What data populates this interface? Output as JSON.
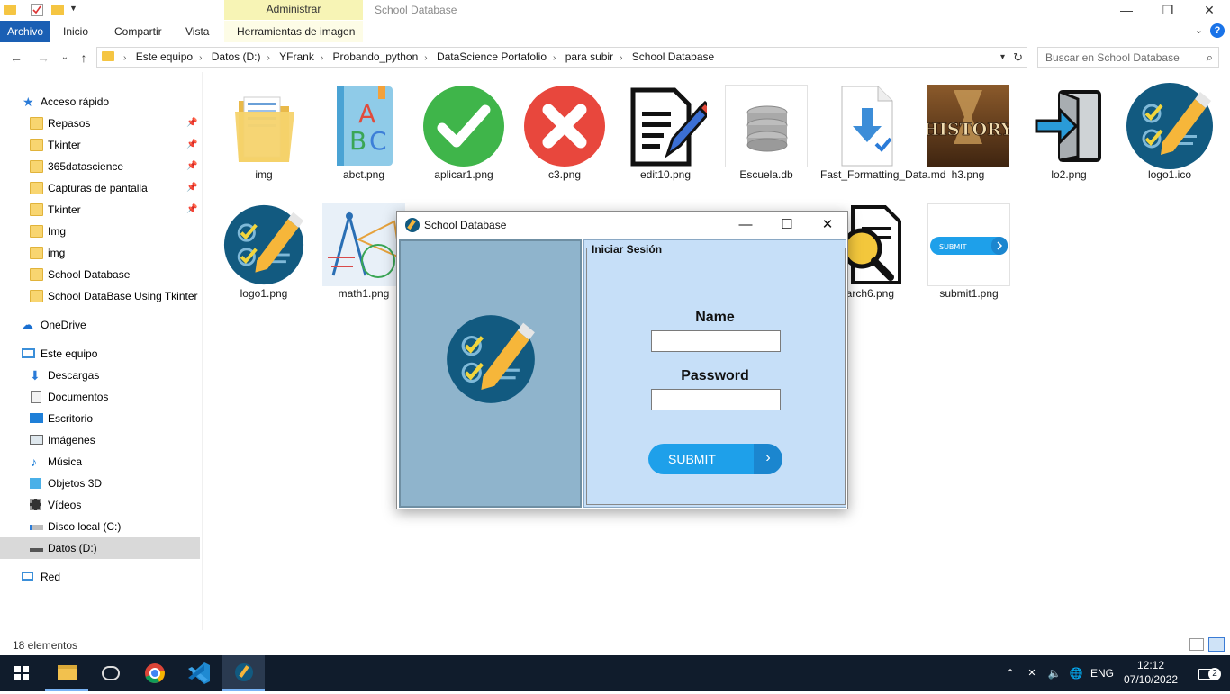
{
  "window": {
    "title": "School Database",
    "context_tab": "Administrar"
  },
  "ribbon": {
    "tabs": [
      "Archivo",
      "Inicio",
      "Compartir",
      "Vista",
      "Herramientas de imagen"
    ]
  },
  "address": {
    "crumbs": [
      "Este equipo",
      "Datos (D:)",
      "YFrank",
      "Probando_python",
      "DataScience Portafolio",
      "para subir",
      "School Database"
    ]
  },
  "search": {
    "placeholder": "Buscar en School Database"
  },
  "sidebar": {
    "quick_access": "Acceso rápido",
    "pinned": [
      "Repasos",
      "Tkinter",
      "365datascience",
      "Capturas de pantalla",
      "Tkinter"
    ],
    "folders": [
      "Img",
      "img",
      "School Database",
      "School DataBase Using Tkinter"
    ],
    "onedrive": "OneDrive",
    "this_pc": "Este equipo",
    "pc_items": [
      "Descargas",
      "Documentos",
      "Escritorio",
      "Imágenes",
      "Música",
      "Objetos 3D",
      "Vídeos",
      "Disco local (C:)",
      "Datos (D:)"
    ],
    "network": "Red"
  },
  "files": [
    "img",
    "abct.png",
    "aplicar1.png",
    "c3.png",
    "edit10.png",
    "Escuela.db",
    "Fast_Formatting_Data.md",
    "h3.png",
    "lo2.png",
    "logo1.ico",
    "logo1.png",
    "math1.png",
    "earch6.png",
    "submit1.png"
  ],
  "thumb_text": {
    "history": "HISTORY",
    "submit_small": "SUBMIT"
  },
  "status": {
    "count": "18 elementos"
  },
  "taskbar": {
    "lang": "ENG",
    "time": "12:12",
    "date": "07/10/2022",
    "notif_count": "2"
  },
  "dialog": {
    "title": "School Database",
    "frame_title": "Iniciar Sesión",
    "name_label": "Name",
    "password_label": "Password",
    "submit_label": "SUBMIT",
    "name_value": "",
    "password_value": ""
  },
  "colors": {
    "accent": "#1a5fb4",
    "left_panel": "#8fb4cc",
    "right_panel": "#c6dff8",
    "submit": "#1ea0ea",
    "taskbar": "#101c2c"
  }
}
